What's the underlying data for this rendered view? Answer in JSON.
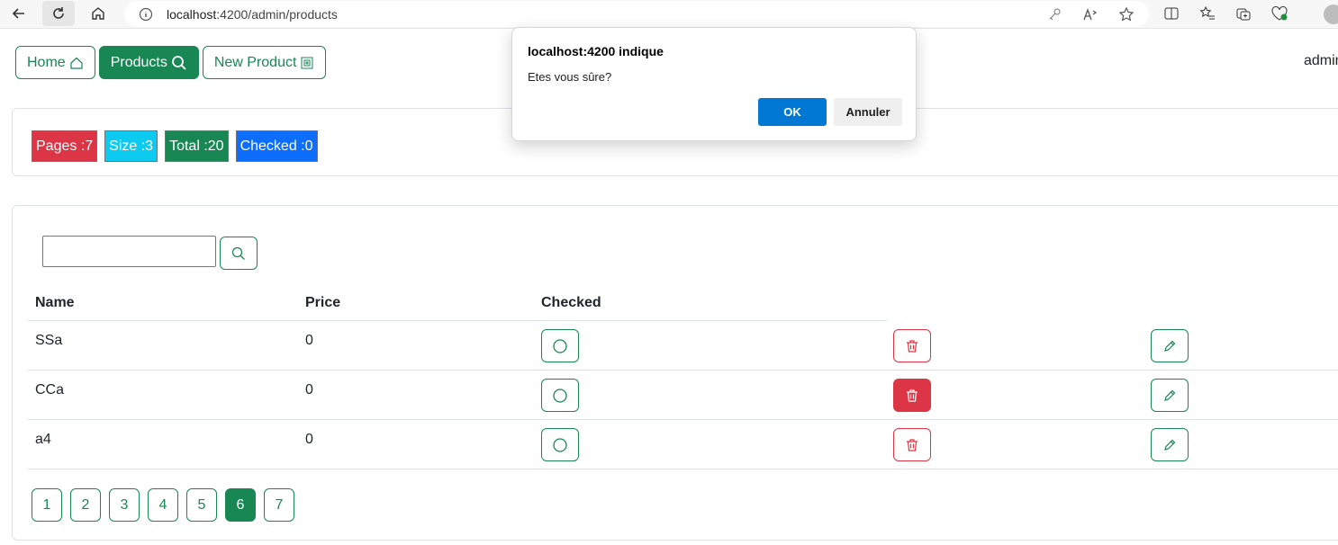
{
  "browser": {
    "url_host": "localhost",
    "url_rest": ":4200/admin/products",
    "icons": [
      "back-icon",
      "refresh-icon",
      "home-icon",
      "info-icon",
      "key-icon",
      "read-aloud-icon",
      "favorite-icon",
      "split-screen-icon",
      "favorites-icon",
      "collections-icon",
      "browser-essentials-icon",
      "profile-icon"
    ]
  },
  "nav": {
    "home_label": "Home",
    "products_label": "Products",
    "new_product_label": "New Product",
    "user": "admin"
  },
  "badges": {
    "pages": "Pages :7",
    "size": "Size :3",
    "total": "Total :20",
    "checked": "Checked :0"
  },
  "search": {
    "value": "",
    "placeholder": ""
  },
  "table": {
    "headers": [
      "Name",
      "Price",
      "Checked"
    ],
    "rows": [
      {
        "name": "SSa",
        "price": "0"
      },
      {
        "name": "CCa",
        "price": "0"
      },
      {
        "name": "a4",
        "price": "0"
      }
    ]
  },
  "pager": [
    "1",
    "2",
    "3",
    "4",
    "5",
    "6",
    "7"
  ],
  "pager_active": "6",
  "dialog": {
    "title": "localhost:4200 indique",
    "message": "Etes vous sûre?",
    "ok_label": "OK",
    "cancel_label": "Annuler"
  },
  "colors": {
    "success": "#198754",
    "danger": "#dc3545",
    "info": "#0dcaf0",
    "primary": "#0d6efd",
    "dialog_ok": "#0078d4"
  }
}
